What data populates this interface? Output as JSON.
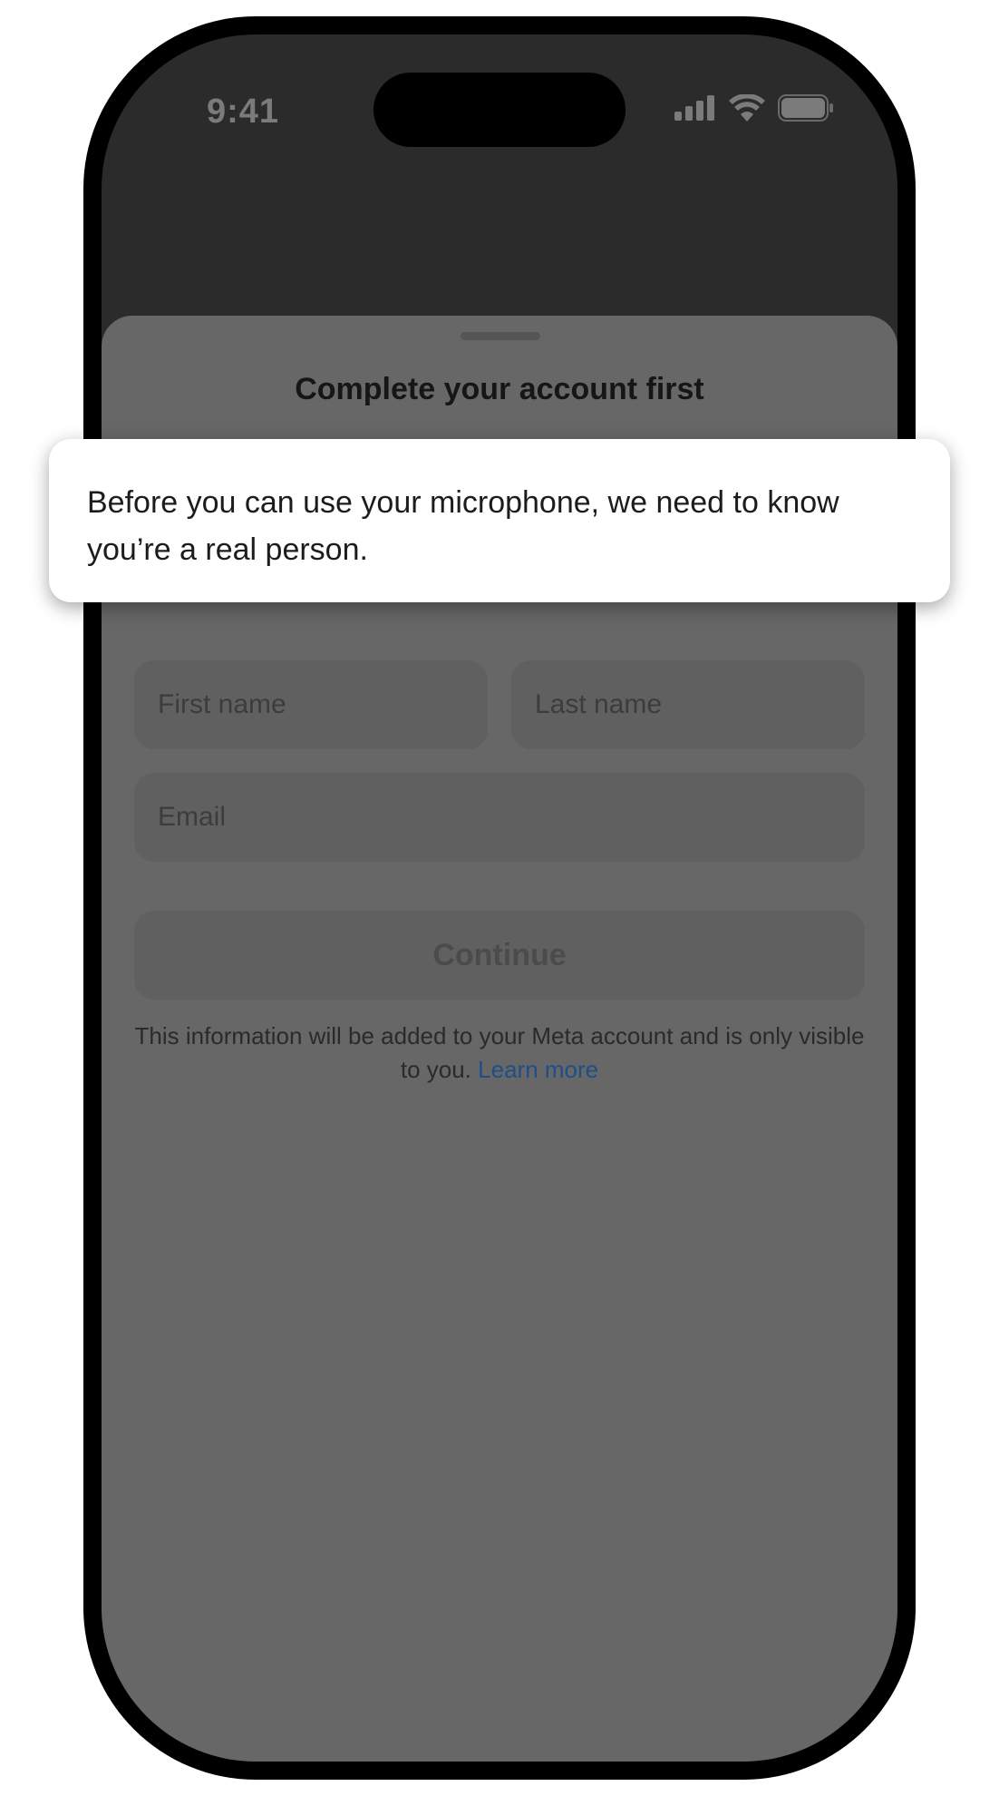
{
  "status_bar": {
    "time": "9:41",
    "icons": [
      "cellular-signal-icon",
      "wifi-icon",
      "battery-icon"
    ]
  },
  "sheet": {
    "title": "Complete your account first",
    "fields": {
      "first_name_placeholder": "First name",
      "last_name_placeholder": "Last name",
      "email_placeholder": "Email"
    },
    "continue_label": "Continue",
    "disclaimer_text": "This information will be added to your Meta account and is only visible to you.",
    "learn_more_label": "Learn more"
  },
  "tooltip": {
    "text": "Before you can use your microphone, we need to know you’re a real person."
  },
  "colors": {
    "overlay_sheet": "#676767",
    "link": "#1e4f88",
    "tooltip_bg": "#ffffff"
  }
}
